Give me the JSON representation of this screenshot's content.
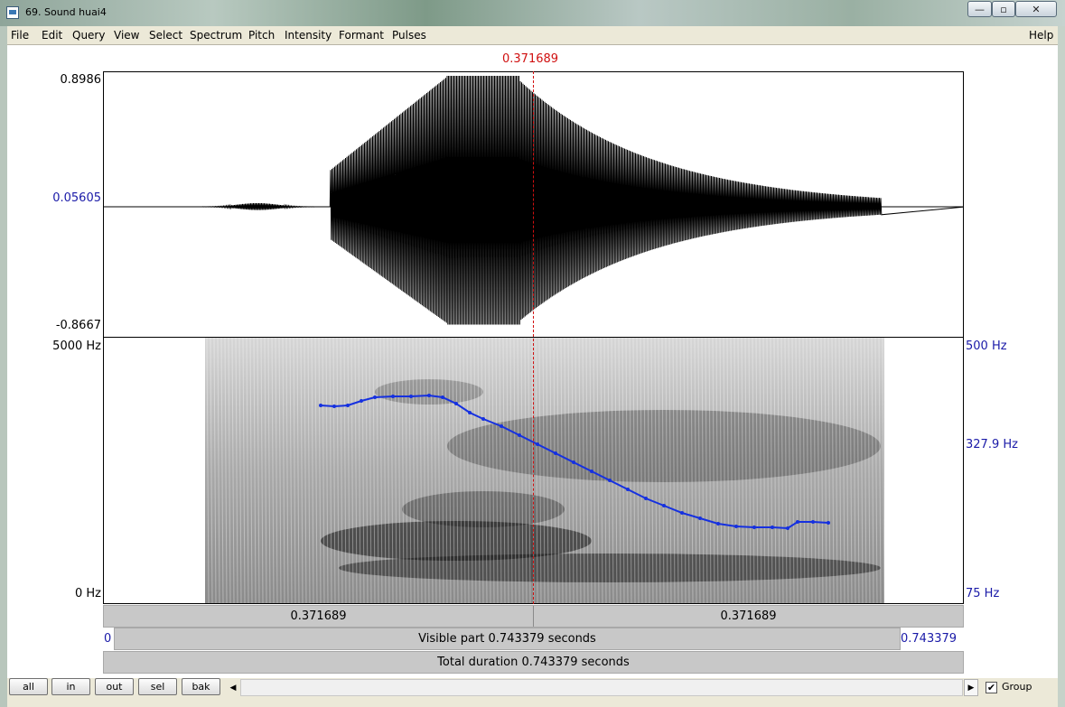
{
  "window": {
    "title": "69. Sound huai4",
    "min_glyph": "—",
    "max_glyph": "▫",
    "close_glyph": "✕"
  },
  "menu": {
    "items": [
      "File",
      "Edit",
      "Query",
      "View",
      "Select",
      "Spectrum",
      "Pitch",
      "Intensity",
      "Formant",
      "Pulses"
    ],
    "help": "Help"
  },
  "cursor": {
    "time_label": "0.371689",
    "time": 0.371689
  },
  "waveform": {
    "max_label": "0.8986",
    "mid_label": "0.05605",
    "min_label": "-0.8667"
  },
  "spectrogram": {
    "top_label": "5000 Hz",
    "bottom_label": "0 Hz",
    "pitch_top_label": "500 Hz",
    "pitch_mid_label": "327.9 Hz",
    "pitch_bottom_label": "75 Hz"
  },
  "timebars": {
    "left_segment": "0.371689",
    "right_segment": "0.371689",
    "visible_start": "0",
    "visible_text": "Visible part 0.743379 seconds",
    "visible_end": "0.743379",
    "total_text": "Total duration 0.743379 seconds"
  },
  "buttons": {
    "all": "all",
    "in": "in",
    "out": "out",
    "sel": "sel",
    "bak": "bak",
    "group_label": "Group",
    "group_checked": "✔",
    "scroll_left": "◀",
    "scroll_right": "▶"
  },
  "colors": {
    "cursor": "#d01010",
    "pitch_curve": "#1530e0",
    "axis_blue": "#1a1aa8"
  }
}
